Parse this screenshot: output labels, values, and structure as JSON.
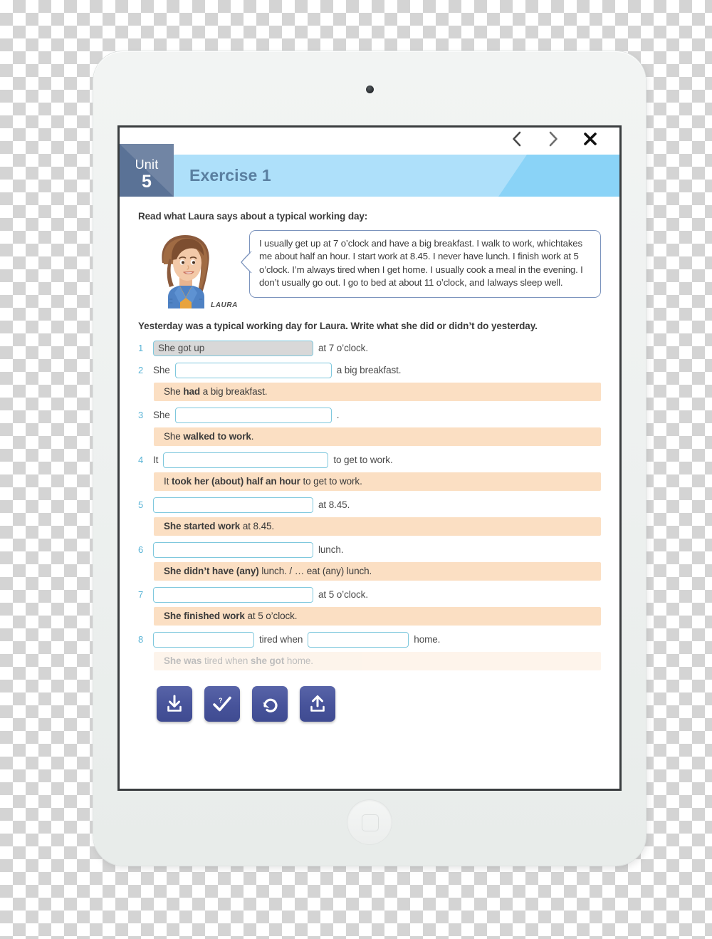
{
  "device": {
    "name": "tablet",
    "camera": "camera-icon",
    "home_button": "home-button"
  },
  "topbar": {
    "prev_label": "‹",
    "next_label": "›",
    "close_label": "✕",
    "prev_name": "previous-page-button",
    "next_name": "next-page-button",
    "close_name": "close-button"
  },
  "header": {
    "unit_word": "Unit",
    "unit_number": "5",
    "exercise_title": "Exercise 1",
    "badge_color": "#5a7296",
    "bar_color": "#aee0fa",
    "bar_accent_color": "#8ad3f7",
    "title_color": "#5a7fa0"
  },
  "intro": {
    "prompt": "Read what Laura says about a typical working day:",
    "character_name": "LAURA",
    "speech": "I usually get up at 7 o’clock and have a big breakfast.  I walk to work, whichtakes me about half an hour.  I start work at 8.45.  I never have lunch.  I finish work at 5 o’clock.  I’m always tired when I get home.  I usually cook a meal in the evening.  I don’t usually go out.  I go to bed at about 11 o’clock, and Ialways sleep well."
  },
  "task": {
    "prompt": "Yesterday was a typical working day for Laura.  Write what she did or didn’t do yesterday.",
    "answer_bg": "#fbdfc3",
    "input_border": "#7fc8dd",
    "number_color": "#5ab4d6"
  },
  "questions": [
    {
      "number": "1",
      "before": "",
      "input_value": "She got up",
      "input_placeholder": "",
      "after": "at 7 o’clock.",
      "filled": true,
      "answer": null
    },
    {
      "number": "2",
      "before": "She",
      "input_value": "",
      "input_placeholder": "",
      "after": "a big breakfast.",
      "filled": false,
      "answer": {
        "pre": "She ",
        "bold": "had",
        "post": " a big breakfast.",
        "faded": false
      }
    },
    {
      "number": "3",
      "before": "She",
      "input_value": "",
      "input_placeholder": "",
      "after": ".",
      "filled": false,
      "answer": {
        "pre": "She ",
        "bold": "walked to work",
        "post": ".",
        "faded": false
      }
    },
    {
      "number": "4",
      "before": "It",
      "input_value": "",
      "input_placeholder": "",
      "after": "to get to work.",
      "filled": false,
      "answer": {
        "pre": "It ",
        "bold": "took her (about) half an hour",
        "post": " to get to work.",
        "faded": false
      }
    },
    {
      "number": "5",
      "before": "",
      "input_value": "",
      "input_placeholder": "",
      "after": "at 8.45.",
      "filled": false,
      "answer": {
        "pre": "",
        "bold": "She started work",
        "post": " at 8.45.",
        "faded": false
      }
    },
    {
      "number": "6",
      "before": "",
      "input_value": "",
      "input_placeholder": "",
      "after": "lunch.",
      "filled": false,
      "answer": {
        "pre": "",
        "bold": "She didn’t have (any)",
        "post": " lunch. / … eat (any) lunch.",
        "faded": false
      }
    },
    {
      "number": "7",
      "before": "",
      "input_value": "",
      "input_placeholder": "",
      "after": "at 5 o’clock.",
      "filled": false,
      "answer": {
        "pre": "",
        "bold": "She finished work",
        "post": " at 5 o’clock.",
        "faded": false
      }
    },
    {
      "number": "8",
      "before": "",
      "input_value": "",
      "input_placeholder": "",
      "mid": "tired when",
      "input_value2": "",
      "after": "home.",
      "filled": false,
      "answer": {
        "pre": "",
        "bold": "She was",
        "post": " tired when ",
        "bold2": "she got",
        "post2": " home.",
        "faded": true
      }
    }
  ],
  "toolbar": {
    "button_color": "#47539a",
    "buttons": [
      {
        "name": "download-button",
        "icon": "download-icon",
        "label": "Download"
      },
      {
        "name": "check-answers-button",
        "icon": "check-question-icon",
        "label": "Check answers"
      },
      {
        "name": "reset-button",
        "icon": "undo-arrow-icon",
        "label": "Reset"
      },
      {
        "name": "upload-button",
        "icon": "upload-icon",
        "label": "Upload"
      }
    ]
  }
}
